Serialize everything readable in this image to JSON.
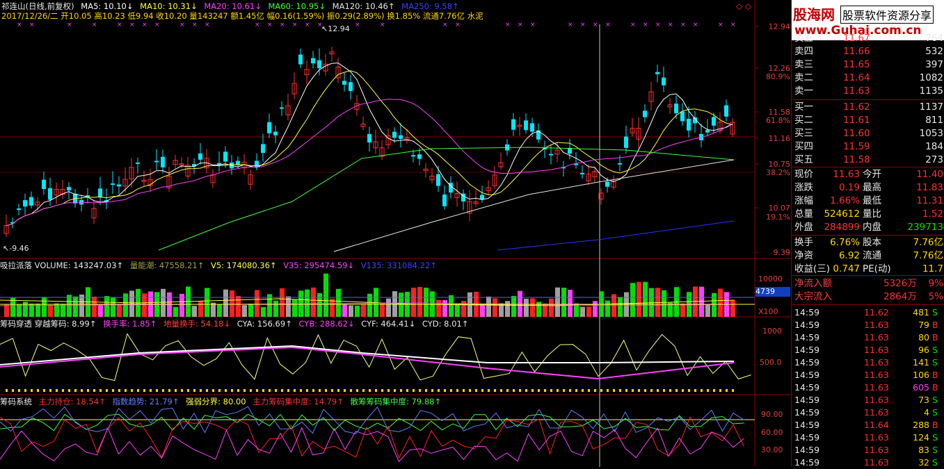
{
  "header": {
    "name": "祁连山(日线,前复权)",
    "ma5": "MA5: 10.10↓",
    "ma10": "MA10: 10.31↓",
    "ma20": "MA20: 10.61↓",
    "ma60": "MA60: 10.95↓",
    "ma120": "MA120: 10.46↑",
    "ma250": "MA250: 9.58↑",
    "info": "2017/12/26/二 开10.05 高10.23 低9.94 收10.20 量143247 额1.45亿 幅0.16(1.59%) 振0.29(2.89%) 换1.85% 流通7.76亿 水泥"
  },
  "price_axis": [
    "12.94",
    "12.26",
    "11.58",
    "11.16",
    "10.75",
    "10.07",
    "9.39"
  ],
  "pct_axis": [
    "80.9%",
    "61.8%",
    "38.2%",
    "19.1%"
  ],
  "price_marks": {
    "high": "12.94",
    "low": "9.46"
  },
  "volume_panel": {
    "title": "吸拉派落 VOLUME: 143247.03↑",
    "fields": [
      "量能潮: 47558.21↑",
      "V5: 174080.36↑",
      "V35: 295474.59↓",
      "V135: 331084.22↑"
    ],
    "axis": [
      "10000",
      "4739",
      "X100"
    ]
  },
  "chip_panel": {
    "title": "筹码穿透 穿越筹码: 8.99↑",
    "fields": [
      "换手率: 1.85↑",
      "地量换手: 54.18↓",
      "CYA: 156.69↑",
      "CYB: 288.62↓",
      "CYF: 464.41↓",
      "CYD: 8.01↑"
    ],
    "axis": [
      "1000",
      "500.0"
    ]
  },
  "system_panel": {
    "title": "筹码系统",
    "fields": [
      "主力持仓: 18.54↑",
      "指数趋势: 21.79↑",
      "强弱分界: 80.00",
      "主力筹码集中度: 14.79↑",
      "散筹筹码集中度: 79.88↑"
    ],
    "axis": [
      "90.00",
      "60.00",
      "30.00"
    ]
  },
  "logo": {
    "cn": "股海网",
    "slogan": "股票软件资源分享",
    "url": "www.Guhai.com.cn"
  },
  "order_book": {
    "asks": [
      {
        "label": "卖五",
        "price": "11.67",
        "vol": "764"
      },
      {
        "label": "卖四",
        "price": "11.66",
        "vol": "532"
      },
      {
        "label": "卖三",
        "price": "11.65",
        "vol": "397"
      },
      {
        "label": "卖二",
        "price": "11.64",
        "vol": "1082"
      },
      {
        "label": "卖一",
        "price": "11.63",
        "vol": "1135"
      }
    ],
    "bids": [
      {
        "label": "买一",
        "price": "11.62",
        "vol": "1137"
      },
      {
        "label": "买二",
        "price": "11.61",
        "vol": "811"
      },
      {
        "label": "买三",
        "price": "11.60",
        "vol": "1053"
      },
      {
        "label": "买四",
        "price": "11.59",
        "vol": "184"
      },
      {
        "label": "买五",
        "price": "11.58",
        "vol": "273"
      }
    ]
  },
  "stats": [
    [
      {
        "t": "现价",
        "c": "#e8e8e8"
      },
      {
        "t": "11.63",
        "c": "#ff3030"
      },
      {
        "t": "今开",
        "c": "#e8e8e8"
      },
      {
        "t": "11.40",
        "c": "#ff3030"
      }
    ],
    [
      {
        "t": "涨跌",
        "c": "#e8e8e8"
      },
      {
        "t": "0.19",
        "c": "#ff3030"
      },
      {
        "t": "最高",
        "c": "#e8e8e8"
      },
      {
        "t": "11.83",
        "c": "#ff3030"
      }
    ],
    [
      {
        "t": "涨幅",
        "c": "#e8e8e8"
      },
      {
        "t": "1.66%",
        "c": "#ff3030"
      },
      {
        "t": "最低",
        "c": "#e8e8e8"
      },
      {
        "t": "11.31",
        "c": "#ff3030"
      }
    ],
    [
      {
        "t": "总量",
        "c": "#e8e8e8"
      },
      {
        "t": "524612",
        "c": "#ffd800"
      },
      {
        "t": "量比",
        "c": "#e8e8e8"
      },
      {
        "t": "1.52",
        "c": "#ff3030"
      }
    ],
    [
      {
        "t": "外盘",
        "c": "#e8e8e8"
      },
      {
        "t": "284899",
        "c": "#ff3030"
      },
      {
        "t": "内盘",
        "c": "#e8e8e8"
      },
      {
        "t": "239713",
        "c": "#00e000"
      }
    ],
    [
      {
        "t": "换手",
        "c": "#e8e8e8"
      },
      {
        "t": "6.76%",
        "c": "#ffd800"
      },
      {
        "t": "股本",
        "c": "#e8e8e8"
      },
      {
        "t": "7.76亿",
        "c": "#ffd800"
      }
    ],
    [
      {
        "t": "净资",
        "c": "#e8e8e8"
      },
      {
        "t": "6.92",
        "c": "#ffd800"
      },
      {
        "t": "流通",
        "c": "#e8e8e8"
      },
      {
        "t": "7.76亿",
        "c": "#ffd800"
      }
    ],
    [
      {
        "t": "收益(三)",
        "c": "#e8e8e8"
      },
      {
        "t": "0.747",
        "c": "#ffd800"
      },
      {
        "t": "PE(动)",
        "c": "#e8e8e8"
      },
      {
        "t": "11.7",
        "c": "#ffd800"
      }
    ]
  ],
  "flow": [
    {
      "label": "净流入额",
      "value": "5326万",
      "pct": "9%"
    },
    {
      "label": "大宗流入",
      "value": "2864万",
      "pct": "5%"
    }
  ],
  "ticks": [
    {
      "time": "14:59",
      "price": "11.62",
      "vol": "481",
      "dir": "S"
    },
    {
      "time": "14:59",
      "price": "11.63",
      "vol": "79",
      "dir": "B"
    },
    {
      "time": "14:59",
      "price": "11.63",
      "vol": "80",
      "dir": "B"
    },
    {
      "time": "14:59",
      "price": "11.63",
      "vol": "96",
      "dir": "S"
    },
    {
      "time": "14:59",
      "price": "11.63",
      "vol": "141",
      "dir": "S"
    },
    {
      "time": "14:59",
      "price": "11.63",
      "vol": "106",
      "dir": "B"
    },
    {
      "time": "14:59",
      "price": "11.63",
      "vol": "605",
      "dir": "B"
    },
    {
      "time": "14:59",
      "price": "11.63",
      "vol": "73",
      "dir": "S"
    },
    {
      "time": "14:59",
      "price": "11.63",
      "vol": "4",
      "dir": "S"
    },
    {
      "time": "14:59",
      "price": "11.64",
      "vol": "288",
      "dir": "B"
    },
    {
      "time": "14:59",
      "price": "11.63",
      "vol": "124",
      "dir": "S"
    },
    {
      "time": "14:59",
      "price": "11.63",
      "vol": "83",
      "dir": "S"
    },
    {
      "time": "14:59",
      "price": "11.63",
      "vol": "32",
      "dir": "S"
    }
  ],
  "colors": {
    "up": "#ff3030",
    "down": "#00e8ff",
    "grid": "#8b0000"
  }
}
